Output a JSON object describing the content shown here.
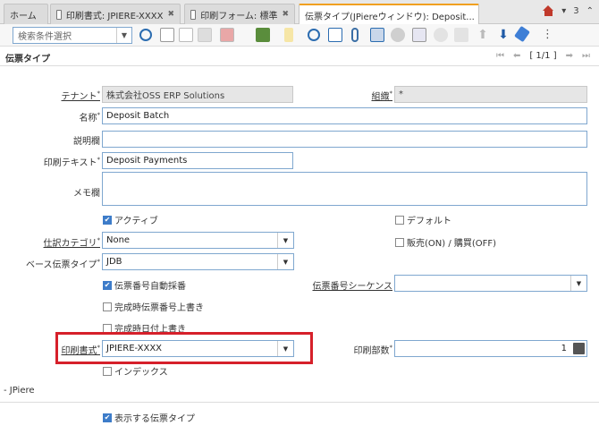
{
  "tabs": [
    {
      "label": "ホーム"
    },
    {
      "label": "印刷書式: JPIERE-XXXX"
    },
    {
      "label": "印刷フォーム: 標準"
    },
    {
      "label": "伝票タイプ(JPiereウィンドウ): Deposit..."
    }
  ],
  "tabbar_right": {
    "count": "3"
  },
  "toolbar": {
    "search_placeholder": "検索条件選択"
  },
  "header": {
    "title": "伝票タイプ",
    "record_counter": "[ 1/1 ]"
  },
  "form": {
    "tenant": {
      "label": "テナント",
      "value": "株式会社OSS ERP Solutions"
    },
    "org": {
      "label": "組織",
      "value": "*"
    },
    "name": {
      "label": "名称",
      "value": "Deposit Batch"
    },
    "description": {
      "label": "説明欄",
      "value": ""
    },
    "print_text": {
      "label": "印刷テキスト",
      "value": "Deposit Payments"
    },
    "memo": {
      "label": "メモ欄",
      "value": ""
    },
    "active": {
      "label": "アクティブ",
      "checked": true
    },
    "default": {
      "label": "デフォルト",
      "checked": false
    },
    "gl_category": {
      "label": "仕訳カテゴリ",
      "value": "None"
    },
    "sales_tx": {
      "label": "販売(ON) / 購買(OFF)",
      "checked": false
    },
    "base_doctype": {
      "label": "ベース伝票タイプ",
      "value": "JDB"
    },
    "auto_numbering": {
      "label": "伝票番号自動採番",
      "checked": true
    },
    "doc_sequence": {
      "label": "伝票番号シーケンス",
      "value": ""
    },
    "overwrite_seq": {
      "label": "完成時伝票番号上書き",
      "checked": false
    },
    "overwrite_date": {
      "label": "完成時日付上書き",
      "checked": false
    },
    "print_format": {
      "label": "印刷書式",
      "value": "JPIERE-XXXX"
    },
    "copies": {
      "label": "印刷部数",
      "value": "1"
    },
    "index": {
      "label": "インデックス",
      "checked": false
    },
    "shown_doctype": {
      "label": "表示する伝票タイプ",
      "checked": true
    }
  },
  "footer": {
    "section": "- JPiere"
  },
  "colors": {
    "accent": "#f0a020",
    "highlight": "#d6202a",
    "checkbox": "#3d7cc9"
  }
}
